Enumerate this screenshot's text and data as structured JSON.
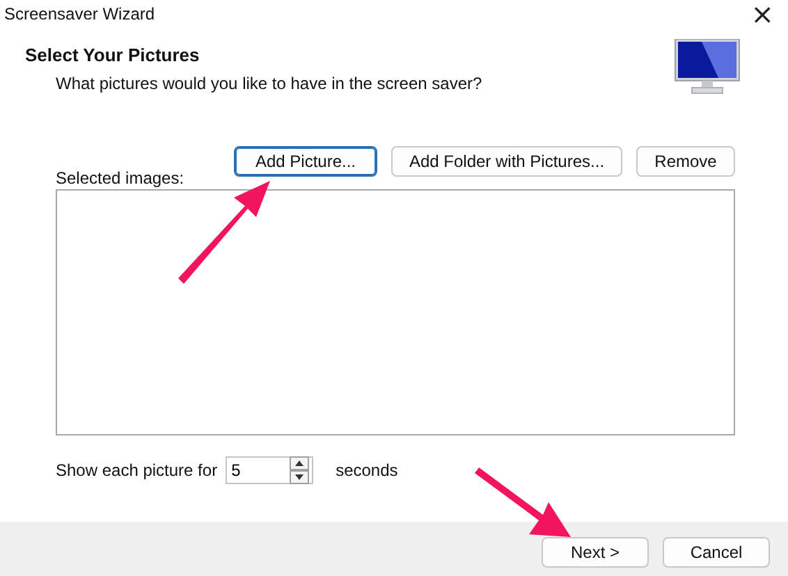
{
  "window": {
    "title": "Screensaver Wizard",
    "close": "×"
  },
  "header": {
    "title": "Select Your Pictures",
    "subtitle": "What pictures would you like to have in the screen saver?"
  },
  "buttons": [
    {
      "label": "Add Picture...",
      "focused": true
    },
    {
      "label": "Add Folder with Pictures...",
      "focused": false
    },
    {
      "label": "Remove",
      "focused": false
    }
  ],
  "list": {
    "label": "Selected images:"
  },
  "duration": {
    "label": "Show each picture for",
    "value": "5",
    "unit": "seconds"
  },
  "footer_buttons": [
    {
      "label": "Next >",
      "focused": false
    },
    {
      "label": "Cancel",
      "focused": false
    }
  ]
}
